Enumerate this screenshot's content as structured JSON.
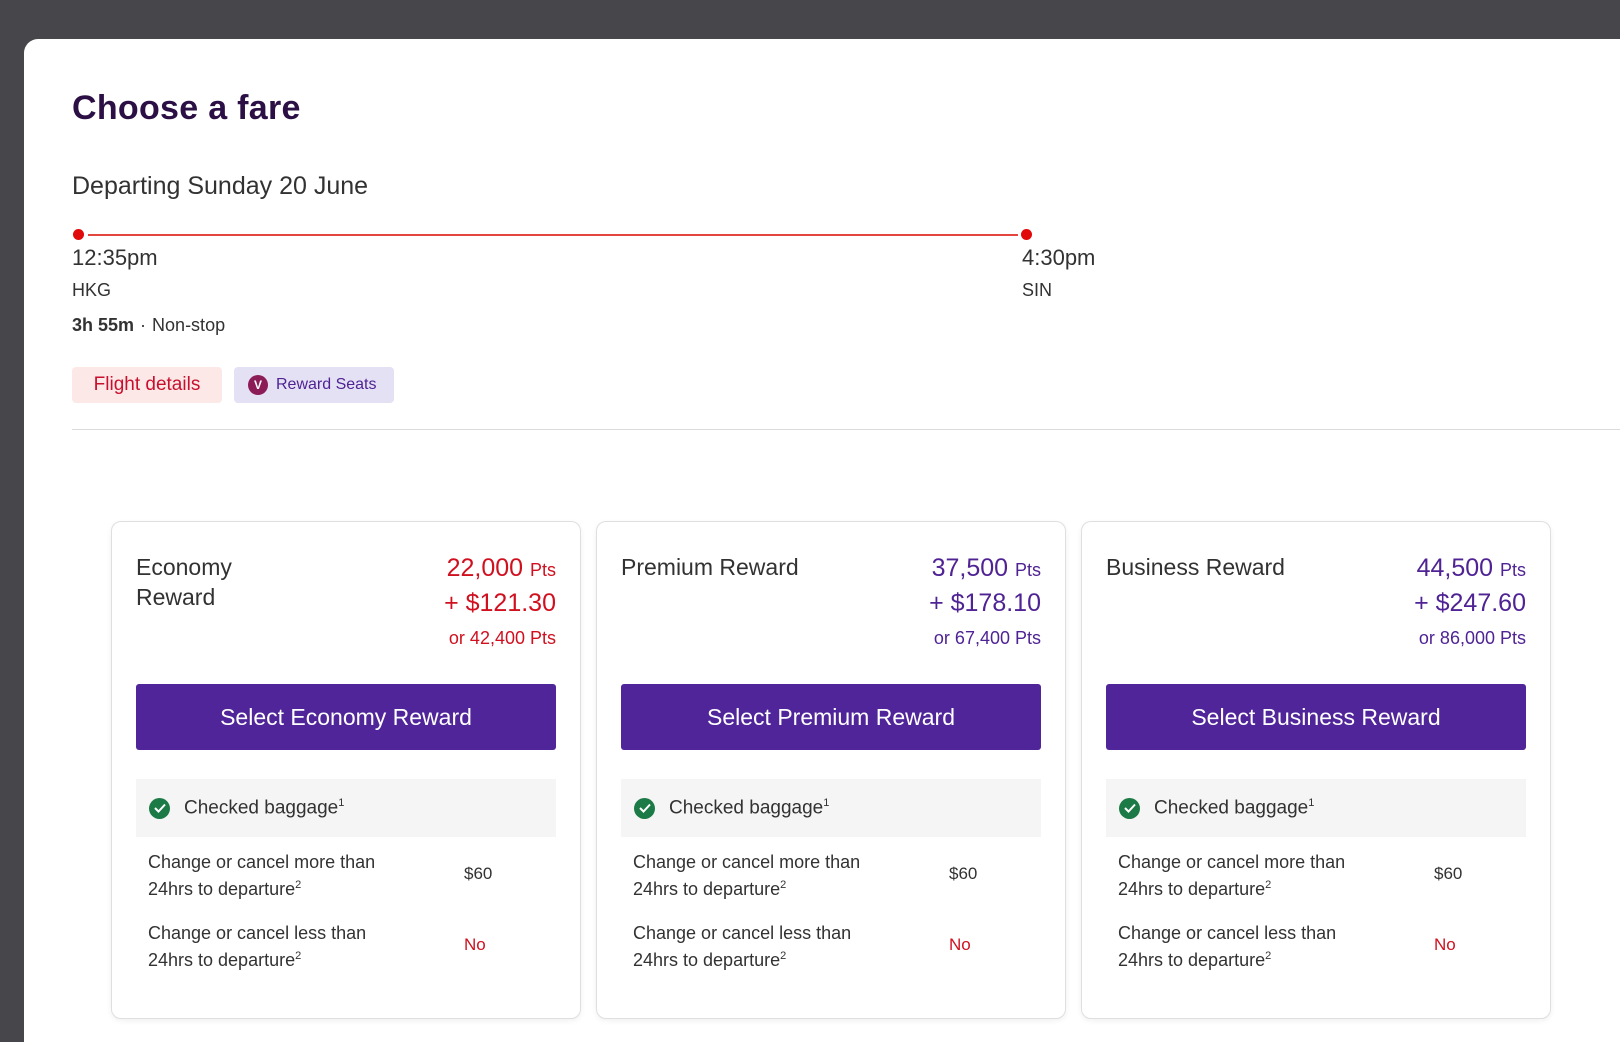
{
  "page": {
    "title": "Choose a fare",
    "departing": "Departing Sunday 20 June"
  },
  "flight": {
    "departure_time": "12:35pm",
    "departure_airport": "HKG",
    "arrival_time": "4:30pm",
    "arrival_airport": "SIN",
    "duration": "3h 55m",
    "separator": "·",
    "stops": "Non-stop"
  },
  "actions": {
    "flight_details": "Flight details",
    "reward_seats": "Reward Seats",
    "reward_badge_letter": "V"
  },
  "cards": [
    {
      "title": "Economy Reward",
      "points": "22,000",
      "points_unit": "Pts",
      "cash": "+ $121.30",
      "alt_points": "or 42,400 Pts",
      "price_color": "#d0101f",
      "button": "Select Economy Reward",
      "baggage": "Checked baggage",
      "baggage_sup": "1",
      "change_more_label": "Change or cancel more than 24hrs to departure",
      "change_more_sup": "2",
      "change_more_value": "$60",
      "change_less_label": "Change or cancel less than 24hrs to departure",
      "change_less_sup": "2",
      "change_less_value": "No"
    },
    {
      "title": "Premium Reward",
      "points": "37,500",
      "points_unit": "Pts",
      "cash": "+ $178.10",
      "alt_points": "or 67,400 Pts",
      "price_color": "#4f2394",
      "button": "Select Premium Reward",
      "baggage": "Checked baggage",
      "baggage_sup": "1",
      "change_more_label": "Change or cancel more than 24hrs to departure",
      "change_more_sup": "2",
      "change_more_value": "$60",
      "change_less_label": "Change or cancel less than 24hrs to departure",
      "change_less_sup": "2",
      "change_less_value": "No"
    },
    {
      "title": "Business Reward",
      "points": "44,500",
      "points_unit": "Pts",
      "cash": "+ $247.60",
      "alt_points": "or 86,000 Pts",
      "price_color": "#4f2394",
      "button": "Select Business Reward",
      "baggage": "Checked baggage",
      "baggage_sup": "1",
      "change_more_label": "Change or cancel more than 24hrs to departure",
      "change_more_sup": "2",
      "change_more_value": "$60",
      "change_less_label": "Change or cancel less than 24hrs to departure",
      "change_less_sup": "2",
      "change_less_value": "No"
    }
  ],
  "colors": {
    "accent": "#51259a",
    "economy_price": "#d0101f",
    "premium_price": "#4f2394",
    "check": "#1c7a46",
    "no_value": "#d0101f"
  }
}
